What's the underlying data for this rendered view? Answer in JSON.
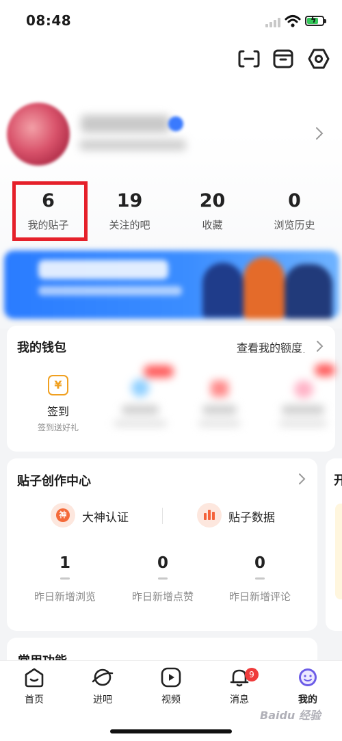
{
  "status_bar": {
    "time": "08:48"
  },
  "header": {
    "icons": [
      "scan-icon",
      "archive-box-icon",
      "settings-icon"
    ]
  },
  "stats": [
    {
      "value": "6",
      "label": "我的贴子"
    },
    {
      "value": "19",
      "label": "关注的吧"
    },
    {
      "value": "20",
      "label": "收藏"
    },
    {
      "value": "0",
      "label": "浏览历史"
    }
  ],
  "wallet": {
    "title": "我的钱包",
    "link": "查看我的额度",
    "items": [
      {
        "icon": "yuan-coin-icon",
        "symbol": "¥",
        "label": "签到",
        "sublabel": "签到送好礼"
      }
    ]
  },
  "creator_center": {
    "title": "贴子创作中心",
    "items": [
      {
        "icon": "shen-badge-icon",
        "symbol": "神",
        "label": "大神认证"
      },
      {
        "icon": "bar-chart-icon",
        "label": "贴子数据"
      }
    ],
    "stats": [
      {
        "value": "1",
        "label": "昨日新增浏览"
      },
      {
        "value": "0",
        "label": "昨日新增点赞"
      },
      {
        "value": "0",
        "label": "昨日新增评论"
      }
    ]
  },
  "side_card": {
    "title": "开"
  },
  "common_functions": {
    "title": "常用功能"
  },
  "bottom_nav": [
    {
      "label": "首页",
      "icon": "home-icon"
    },
    {
      "label": "进吧",
      "icon": "planet-icon"
    },
    {
      "label": "视频",
      "icon": "video-play-icon"
    },
    {
      "label": "消息",
      "icon": "bell-icon",
      "badge": "9"
    },
    {
      "label": "我的",
      "icon": "smiley-icon",
      "active": true
    }
  ],
  "watermark": "Baidu 经验",
  "colors": {
    "accent": "#6c5ce7",
    "highlight_box": "#e5202a",
    "badge_red": "#ef3b3b",
    "coin_orange": "#f0a020",
    "banner_blue": "#2a7cff"
  }
}
